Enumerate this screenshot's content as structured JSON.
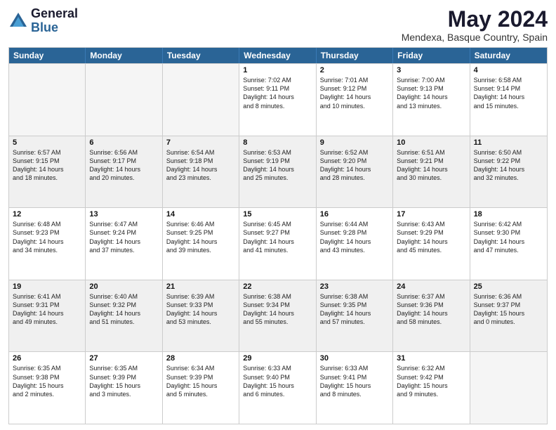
{
  "logo": {
    "general": "General",
    "blue": "Blue"
  },
  "header": {
    "title": "May 2024",
    "subtitle": "Mendexa, Basque Country, Spain"
  },
  "weekdays": [
    "Sunday",
    "Monday",
    "Tuesday",
    "Wednesday",
    "Thursday",
    "Friday",
    "Saturday"
  ],
  "weeks": [
    [
      {
        "day": "",
        "info": "",
        "shaded": false,
        "empty": true
      },
      {
        "day": "",
        "info": "",
        "shaded": false,
        "empty": true
      },
      {
        "day": "",
        "info": "",
        "shaded": false,
        "empty": true
      },
      {
        "day": "1",
        "info": "Sunrise: 7:02 AM\nSunset: 9:11 PM\nDaylight: 14 hours\nand 8 minutes.",
        "shaded": false,
        "empty": false
      },
      {
        "day": "2",
        "info": "Sunrise: 7:01 AM\nSunset: 9:12 PM\nDaylight: 14 hours\nand 10 minutes.",
        "shaded": false,
        "empty": false
      },
      {
        "day": "3",
        "info": "Sunrise: 7:00 AM\nSunset: 9:13 PM\nDaylight: 14 hours\nand 13 minutes.",
        "shaded": false,
        "empty": false
      },
      {
        "day": "4",
        "info": "Sunrise: 6:58 AM\nSunset: 9:14 PM\nDaylight: 14 hours\nand 15 minutes.",
        "shaded": false,
        "empty": false
      }
    ],
    [
      {
        "day": "5",
        "info": "Sunrise: 6:57 AM\nSunset: 9:15 PM\nDaylight: 14 hours\nand 18 minutes.",
        "shaded": true,
        "empty": false
      },
      {
        "day": "6",
        "info": "Sunrise: 6:56 AM\nSunset: 9:17 PM\nDaylight: 14 hours\nand 20 minutes.",
        "shaded": true,
        "empty": false
      },
      {
        "day": "7",
        "info": "Sunrise: 6:54 AM\nSunset: 9:18 PM\nDaylight: 14 hours\nand 23 minutes.",
        "shaded": true,
        "empty": false
      },
      {
        "day": "8",
        "info": "Sunrise: 6:53 AM\nSunset: 9:19 PM\nDaylight: 14 hours\nand 25 minutes.",
        "shaded": true,
        "empty": false
      },
      {
        "day": "9",
        "info": "Sunrise: 6:52 AM\nSunset: 9:20 PM\nDaylight: 14 hours\nand 28 minutes.",
        "shaded": true,
        "empty": false
      },
      {
        "day": "10",
        "info": "Sunrise: 6:51 AM\nSunset: 9:21 PM\nDaylight: 14 hours\nand 30 minutes.",
        "shaded": true,
        "empty": false
      },
      {
        "day": "11",
        "info": "Sunrise: 6:50 AM\nSunset: 9:22 PM\nDaylight: 14 hours\nand 32 minutes.",
        "shaded": true,
        "empty": false
      }
    ],
    [
      {
        "day": "12",
        "info": "Sunrise: 6:48 AM\nSunset: 9:23 PM\nDaylight: 14 hours\nand 34 minutes.",
        "shaded": false,
        "empty": false
      },
      {
        "day": "13",
        "info": "Sunrise: 6:47 AM\nSunset: 9:24 PM\nDaylight: 14 hours\nand 37 minutes.",
        "shaded": false,
        "empty": false
      },
      {
        "day": "14",
        "info": "Sunrise: 6:46 AM\nSunset: 9:25 PM\nDaylight: 14 hours\nand 39 minutes.",
        "shaded": false,
        "empty": false
      },
      {
        "day": "15",
        "info": "Sunrise: 6:45 AM\nSunset: 9:27 PM\nDaylight: 14 hours\nand 41 minutes.",
        "shaded": false,
        "empty": false
      },
      {
        "day": "16",
        "info": "Sunrise: 6:44 AM\nSunset: 9:28 PM\nDaylight: 14 hours\nand 43 minutes.",
        "shaded": false,
        "empty": false
      },
      {
        "day": "17",
        "info": "Sunrise: 6:43 AM\nSunset: 9:29 PM\nDaylight: 14 hours\nand 45 minutes.",
        "shaded": false,
        "empty": false
      },
      {
        "day": "18",
        "info": "Sunrise: 6:42 AM\nSunset: 9:30 PM\nDaylight: 14 hours\nand 47 minutes.",
        "shaded": false,
        "empty": false
      }
    ],
    [
      {
        "day": "19",
        "info": "Sunrise: 6:41 AM\nSunset: 9:31 PM\nDaylight: 14 hours\nand 49 minutes.",
        "shaded": true,
        "empty": false
      },
      {
        "day": "20",
        "info": "Sunrise: 6:40 AM\nSunset: 9:32 PM\nDaylight: 14 hours\nand 51 minutes.",
        "shaded": true,
        "empty": false
      },
      {
        "day": "21",
        "info": "Sunrise: 6:39 AM\nSunset: 9:33 PM\nDaylight: 14 hours\nand 53 minutes.",
        "shaded": true,
        "empty": false
      },
      {
        "day": "22",
        "info": "Sunrise: 6:38 AM\nSunset: 9:34 PM\nDaylight: 14 hours\nand 55 minutes.",
        "shaded": true,
        "empty": false
      },
      {
        "day": "23",
        "info": "Sunrise: 6:38 AM\nSunset: 9:35 PM\nDaylight: 14 hours\nand 57 minutes.",
        "shaded": true,
        "empty": false
      },
      {
        "day": "24",
        "info": "Sunrise: 6:37 AM\nSunset: 9:36 PM\nDaylight: 14 hours\nand 58 minutes.",
        "shaded": true,
        "empty": false
      },
      {
        "day": "25",
        "info": "Sunrise: 6:36 AM\nSunset: 9:37 PM\nDaylight: 15 hours\nand 0 minutes.",
        "shaded": true,
        "empty": false
      }
    ],
    [
      {
        "day": "26",
        "info": "Sunrise: 6:35 AM\nSunset: 9:38 PM\nDaylight: 15 hours\nand 2 minutes.",
        "shaded": false,
        "empty": false
      },
      {
        "day": "27",
        "info": "Sunrise: 6:35 AM\nSunset: 9:39 PM\nDaylight: 15 hours\nand 3 minutes.",
        "shaded": false,
        "empty": false
      },
      {
        "day": "28",
        "info": "Sunrise: 6:34 AM\nSunset: 9:39 PM\nDaylight: 15 hours\nand 5 minutes.",
        "shaded": false,
        "empty": false
      },
      {
        "day": "29",
        "info": "Sunrise: 6:33 AM\nSunset: 9:40 PM\nDaylight: 15 hours\nand 6 minutes.",
        "shaded": false,
        "empty": false
      },
      {
        "day": "30",
        "info": "Sunrise: 6:33 AM\nSunset: 9:41 PM\nDaylight: 15 hours\nand 8 minutes.",
        "shaded": false,
        "empty": false
      },
      {
        "day": "31",
        "info": "Sunrise: 6:32 AM\nSunset: 9:42 PM\nDaylight: 15 hours\nand 9 minutes.",
        "shaded": false,
        "empty": false
      },
      {
        "day": "",
        "info": "",
        "shaded": false,
        "empty": true
      }
    ]
  ]
}
